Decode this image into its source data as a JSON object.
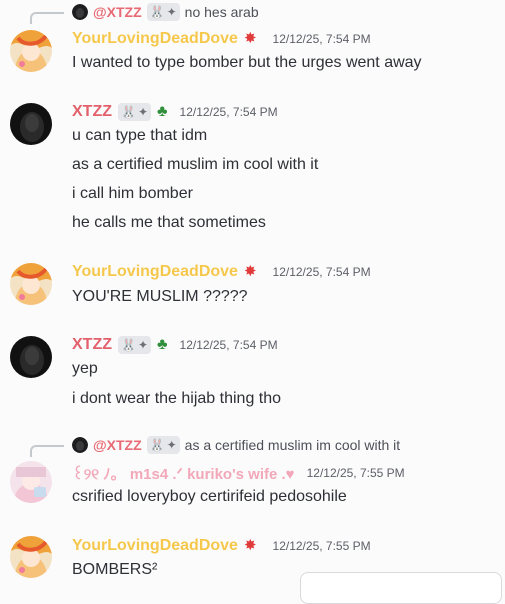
{
  "messages": [
    {
      "reply": {
        "username": "@XTZZ",
        "text": "no hes arab"
      },
      "author": "YourLovingDeadDove",
      "timestamp": "12/12/25, 7:54 PM",
      "lines": [
        "I wanted to type bomber but the urges went away"
      ]
    },
    {
      "author": "XTZZ",
      "timestamp": "12/12/25, 7:54 PM",
      "lines": [
        "u can type that idm",
        "as a certified muslim im cool with it",
        "i call him bomber",
        "he calls me that sometimes"
      ]
    },
    {
      "author": "YourLovingDeadDove",
      "timestamp": "12/12/25, 7:54 PM",
      "lines": [
        "YOU'RE MUSLIM ?????"
      ]
    },
    {
      "author": "XTZZ",
      "timestamp": "12/12/25, 7:54 PM",
      "lines": [
        "yep",
        "i dont wear the hijab thing tho"
      ]
    },
    {
      "reply": {
        "username": "@XTZZ",
        "text": "as a certified muslim im cool with it"
      },
      "author": "꒰୨୧ ﾉ。 m1s4 .ᐟ kuriko's wife .♥",
      "timestamp": "12/12/25, 7:55 PM",
      "lines": [
        "csrified loveryboy certirifeid pedosohile"
      ]
    },
    {
      "author": "YourLovingDeadDove",
      "timestamp": "12/12/25, 7:55 PM",
      "lines": [
        "BOMBERS²"
      ]
    }
  ],
  "icons": {
    "bunny": "🐰",
    "sparkle": "✦",
    "clover": "♣",
    "burst": "✸"
  },
  "colors": {
    "dove_name": "#f5c84c",
    "xtzz_name": "#e2616d",
    "misa_name": "#f2a8b8",
    "background": "#fbfbfc"
  }
}
